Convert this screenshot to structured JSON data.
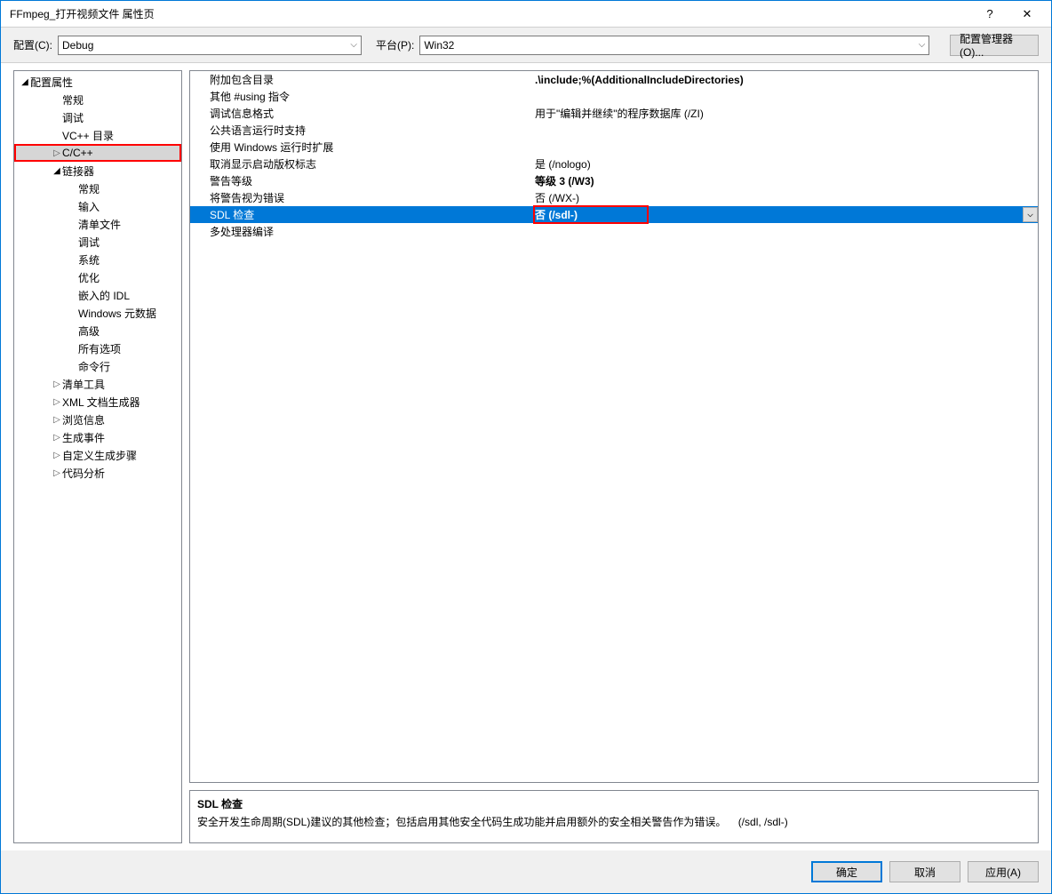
{
  "window": {
    "title": "FFmpeg_打开视频文件 属性页"
  },
  "toolbar": {
    "config_label": "配置(C):",
    "config_value": "Debug",
    "platform_label": "平台(P):",
    "platform_value": "Win32",
    "configmgr": "配置管理器(O)..."
  },
  "tree": {
    "root": "配置属性",
    "items": [
      {
        "label": "常规",
        "level": 2,
        "arrow": ""
      },
      {
        "label": "调试",
        "level": 2,
        "arrow": ""
      },
      {
        "label": "VC++ 目录",
        "level": 2,
        "arrow": ""
      },
      {
        "label": "C/C++",
        "level": 2,
        "arrow": "▷",
        "selected": true,
        "highlighted": true
      },
      {
        "label": "链接器",
        "level": 2,
        "arrow": "◢",
        "open": true
      },
      {
        "label": "常规",
        "level": 3,
        "arrow": ""
      },
      {
        "label": "输入",
        "level": 3,
        "arrow": ""
      },
      {
        "label": "清单文件",
        "level": 3,
        "arrow": ""
      },
      {
        "label": "调试",
        "level": 3,
        "arrow": ""
      },
      {
        "label": "系统",
        "level": 3,
        "arrow": ""
      },
      {
        "label": "优化",
        "level": 3,
        "arrow": ""
      },
      {
        "label": "嵌入的 IDL",
        "level": 3,
        "arrow": ""
      },
      {
        "label": "Windows 元数据",
        "level": 3,
        "arrow": ""
      },
      {
        "label": "高级",
        "level": 3,
        "arrow": ""
      },
      {
        "label": "所有选项",
        "level": 3,
        "arrow": ""
      },
      {
        "label": "命令行",
        "level": 3,
        "arrow": ""
      },
      {
        "label": "清单工具",
        "level": 2,
        "arrow": "▷"
      },
      {
        "label": "XML 文档生成器",
        "level": 2,
        "arrow": "▷"
      },
      {
        "label": "浏览信息",
        "level": 2,
        "arrow": "▷"
      },
      {
        "label": "生成事件",
        "level": 2,
        "arrow": "▷"
      },
      {
        "label": "自定义生成步骤",
        "level": 2,
        "arrow": "▷"
      },
      {
        "label": "代码分析",
        "level": 2,
        "arrow": "▷"
      }
    ]
  },
  "props": [
    {
      "name": "附加包含目录",
      "value": ".\\include;%(AdditionalIncludeDirectories)",
      "bold": true
    },
    {
      "name": "其他 #using 指令",
      "value": ""
    },
    {
      "name": "调试信息格式",
      "value": "用于\"编辑并继续\"的程序数据库 (/ZI)"
    },
    {
      "name": "公共语言运行时支持",
      "value": ""
    },
    {
      "name": "使用 Windows 运行时扩展",
      "value": ""
    },
    {
      "name": "取消显示启动版权标志",
      "value": "是 (/nologo)"
    },
    {
      "name": "警告等级",
      "value": "等级 3 (/W3)",
      "bold": true
    },
    {
      "name": "将警告视为错误",
      "value": "否 (/WX-)"
    },
    {
      "name": "SDL 检查",
      "value": "否 (/sdl-)",
      "bold": true,
      "selected": true,
      "dropdown": true,
      "valHighlight": true
    },
    {
      "name": "多处理器编译",
      "value": ""
    }
  ],
  "desc": {
    "title": "SDL 检查",
    "text": "安全开发生命周期(SDL)建议的其他检查；包括启用其他安全代码生成功能并启用额外的安全相关警告作为错误。",
    "flags": "(/sdl, /sdl-)"
  },
  "footer": {
    "ok": "确定",
    "cancel": "取消",
    "apply": "应用(A)"
  }
}
